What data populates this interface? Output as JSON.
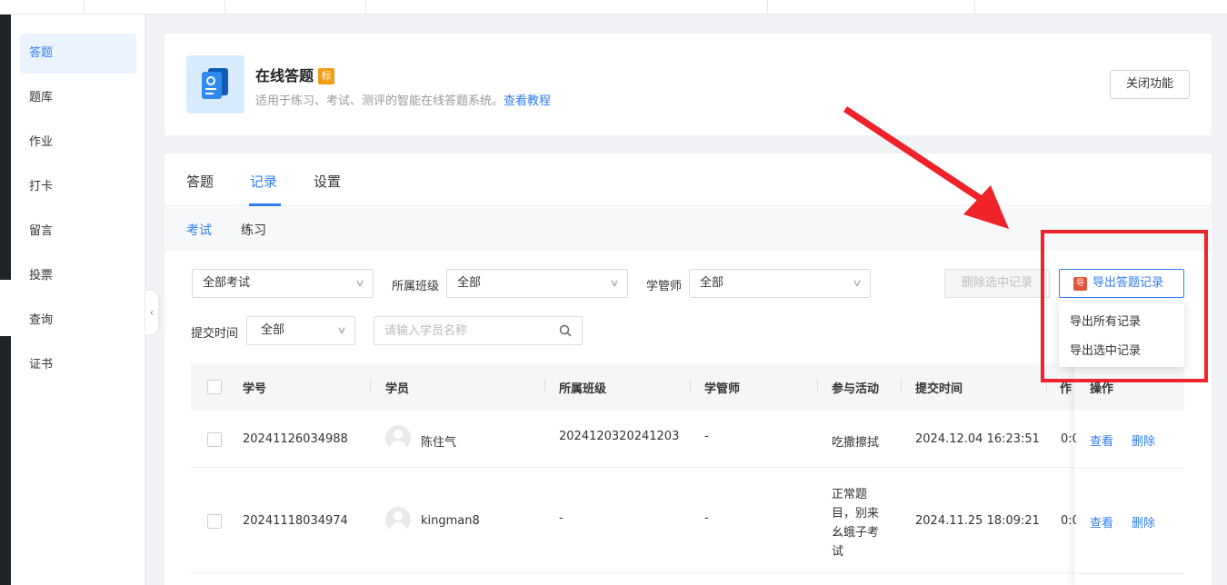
{
  "sidebar": {
    "items": [
      {
        "label": "答题",
        "active": true
      },
      {
        "label": "题库"
      },
      {
        "label": "作业"
      },
      {
        "label": "打卡"
      },
      {
        "label": "留言"
      },
      {
        "label": "投票"
      },
      {
        "label": "查询"
      },
      {
        "label": "证书"
      }
    ]
  },
  "app": {
    "title": "在线答题",
    "badge": "标",
    "description": "适用于练习、考试、测评的智能在线答题系统。",
    "tutorial_link": "查看教程",
    "close_button": "关闭功能"
  },
  "tabs": [
    "答题",
    "记录",
    "设置"
  ],
  "active_tab": "记录",
  "subtabs": [
    "考试",
    "练习"
  ],
  "active_subtab": "考试",
  "filters": {
    "exam_select": "全部考试",
    "class_label": "所属班级",
    "class_select": "全部",
    "manager_label": "学管师",
    "manager_select": "全部",
    "time_label": "提交时间",
    "time_select": "全部",
    "search_placeholder": "请输入学员名称"
  },
  "actions": {
    "delete_selected": "删除选中记录",
    "export": "导出答题记录",
    "export_icon_glyph": "导",
    "export_menu": [
      "导出所有记录",
      "导出选中记录"
    ]
  },
  "table": {
    "headers": {
      "student_id": "学号",
      "student": "学员",
      "class": "所属班级",
      "manager": "学管师",
      "activity": "参与活动",
      "submit_time": "提交时间",
      "truncated": "作",
      "operation": "操作"
    },
    "rows": [
      {
        "student_id": "20241126034988",
        "student": "陈住气",
        "class": "2024120320241203",
        "manager": "-",
        "activity": "吃撒擦拭",
        "submit_time": "2024.12.04 16:23:51",
        "truncated": "0:0",
        "view": "查看",
        "delete": "删除"
      },
      {
        "student_id": "20241118034974",
        "student": "kingman8",
        "class": "-",
        "manager": "-",
        "activity_lines": [
          "正常题",
          "目，别来",
          "幺蛾子考",
          "试"
        ],
        "submit_time": "2024.11.25 18:09:21",
        "truncated": "0:0",
        "view": "查看",
        "delete": "删除"
      }
    ]
  },
  "colors": {
    "accent": "#2f7df6",
    "annotation": "#f0222a",
    "badge": "#f39c12"
  }
}
